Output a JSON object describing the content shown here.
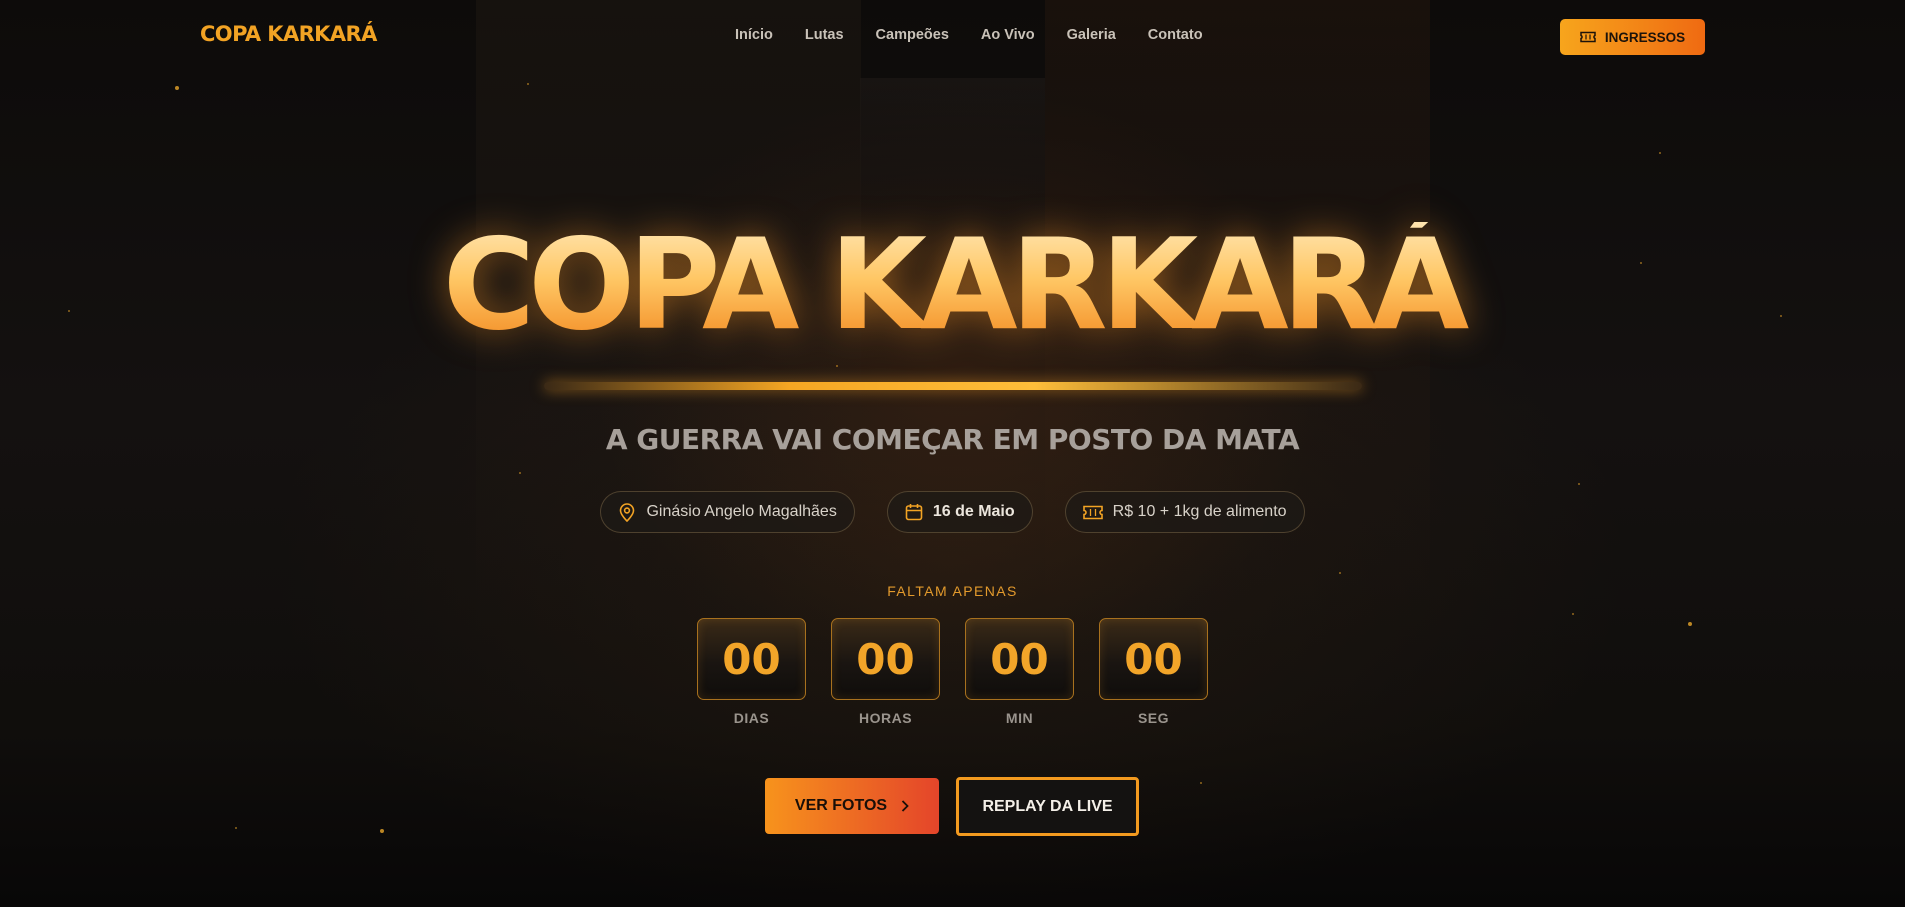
{
  "header": {
    "logo": "COPA KARKARÁ",
    "nav": [
      "Início",
      "Lutas",
      "Campeões",
      "Ao Vivo",
      "Galeria",
      "Contato"
    ],
    "tickets_label": "INGRESSOS"
  },
  "hero": {
    "title": "COPA KARKARÁ",
    "subtitle": "A GUERRA VAI COMEÇAR EM POSTO DA MATA",
    "location": "Ginásio Angelo Magalhães",
    "date": "16 de Maio",
    "price": "R$ 10 + 1kg de alimento"
  },
  "countdown": {
    "label": "FALTAM APENAS",
    "units": [
      {
        "value": "00",
        "label": "DIAS"
      },
      {
        "value": "00",
        "label": "HORAS"
      },
      {
        "value": "00",
        "label": "MIN"
      },
      {
        "value": "00",
        "label": "SEG"
      }
    ]
  },
  "cta": {
    "photos_label": "VER FOTOS",
    "replay_label": "REPLAY DA LIVE"
  },
  "icons": {
    "ticket": "ticket-icon",
    "location": "map-pin-icon",
    "date": "calendar-icon",
    "price": "ticket-icon",
    "arrow": "chevron-right-icon"
  },
  "colors": {
    "accent": "#f2a324",
    "accent_dark": "#ef6a12",
    "cta_end": "#e4452a",
    "background": "#0b0a09"
  }
}
